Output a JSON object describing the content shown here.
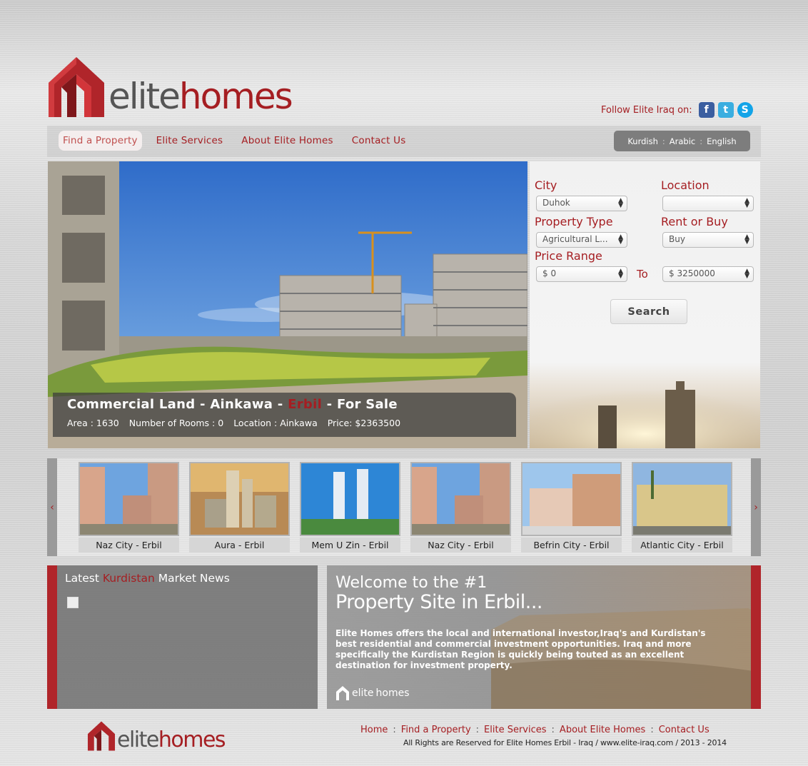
{
  "brand": {
    "name_part1": "elite",
    "name_part2": "homes",
    "red": "#a51e22",
    "gray": "#555555"
  },
  "follow": {
    "label": "Follow Elite Iraq on:",
    "icons": [
      "facebook-icon",
      "twitter-icon",
      "skype-icon"
    ]
  },
  "nav": {
    "items": [
      "Find a Property",
      "Elite Services",
      "About Elite Homes",
      "Contact Us"
    ],
    "active_index": 0
  },
  "languages": [
    "Kurdish",
    "Arabic",
    "English"
  ],
  "hero": {
    "title_part1": "Commercial Land - Ainkawa - ",
    "title_city": "Erbil",
    "title_part2": " - For Sale",
    "area": "Area : 1630",
    "rooms": "Number of Rooms : 0",
    "location": "Location : Ainkawa",
    "price": "Price: $2363500"
  },
  "search": {
    "city_label": "City",
    "city_value": "Duhok",
    "location_label": "Location",
    "location_value": "",
    "type_label": "Property Type",
    "type_value": "Agricultural L...",
    "rent_label": "Rent or Buy",
    "rent_value": "Buy",
    "price_label": "Price Range",
    "price_min": "$ 0",
    "to_label": "To",
    "price_max": "$ 3250000",
    "button": "Search"
  },
  "carousel": {
    "prev": "‹",
    "next": "›",
    "items": [
      {
        "label": "Naz City - Erbil"
      },
      {
        "label": "Aura - Erbil"
      },
      {
        "label": "Mem U Zin - Erbil"
      },
      {
        "label": "Naz City - Erbil"
      },
      {
        "label": "Befrin City - Erbil"
      },
      {
        "label": "Atlantic City - Erbil"
      }
    ]
  },
  "news": {
    "title_part1": "Latest ",
    "title_highlight": "Kurdistan",
    "title_part2": " Market News"
  },
  "welcome": {
    "line1": "Welcome to the #1",
    "line2": "Property Site in Erbil...",
    "body": "Elite Homes offers the local and international investor,Iraq's and Kurdistan's best residential and commercial investment opportunities. Iraq and more specifically the Kurdistan Region is quickly being touted as an excellent destination for investment property."
  },
  "footer": {
    "links": [
      "Home",
      "Find a Property",
      "Elite Services",
      "About Elite Homes",
      "Contact Us"
    ],
    "copyright": "All Rights are Reserved for Elite Homes Erbil - Iraq / www.elite-iraq.com / 2013 - 2014"
  }
}
